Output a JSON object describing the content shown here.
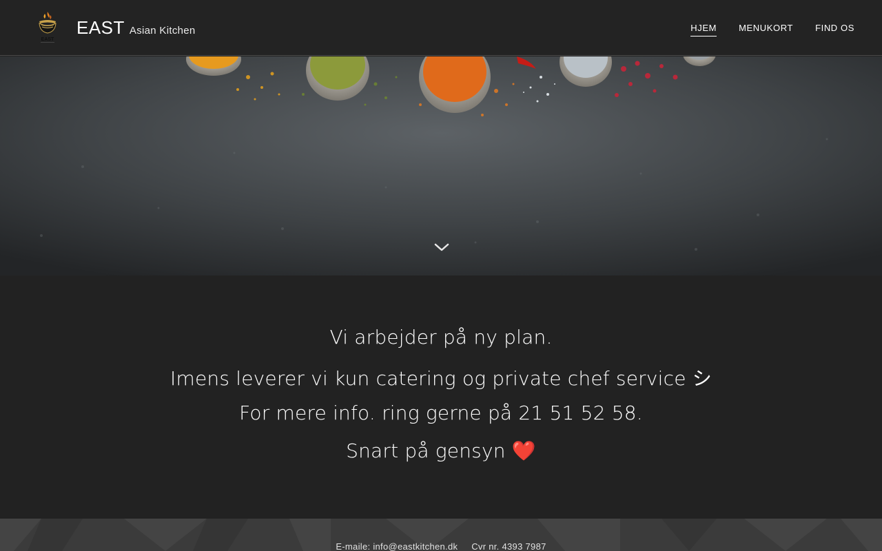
{
  "header": {
    "brand_name": "EAST",
    "brand_tagline": "Asian Kitchen",
    "logo_icon": "noodle-bowl-logo",
    "logo_text": "EAST"
  },
  "nav": {
    "items": [
      {
        "label": "HJEM",
        "active": true
      },
      {
        "label": "MENUKORT",
        "active": false
      },
      {
        "label": "FIND OS",
        "active": false
      }
    ]
  },
  "hero": {
    "image_icon": "spice-spoons-slate-image",
    "scroll_icon": "chevron-down-icon"
  },
  "content": {
    "line1": "Vi arbejder på ny plan.",
    "line2": "Imens leverer vi kun catering og private chef service シ",
    "line3": "For mere info. ring gerne på 21 51 52 58.",
    "line4_text": "Snart på gensyn ",
    "line4_emoji": "❤️"
  },
  "footer": {
    "email": "E-maile: info@eastkitchen.dk",
    "cvr": "Cvr nr. 4393 7987"
  },
  "colors": {
    "header_bg": "#232323",
    "body_bg": "#222222",
    "footer_bg": "#3b3b3b",
    "text": "#ffffff"
  }
}
